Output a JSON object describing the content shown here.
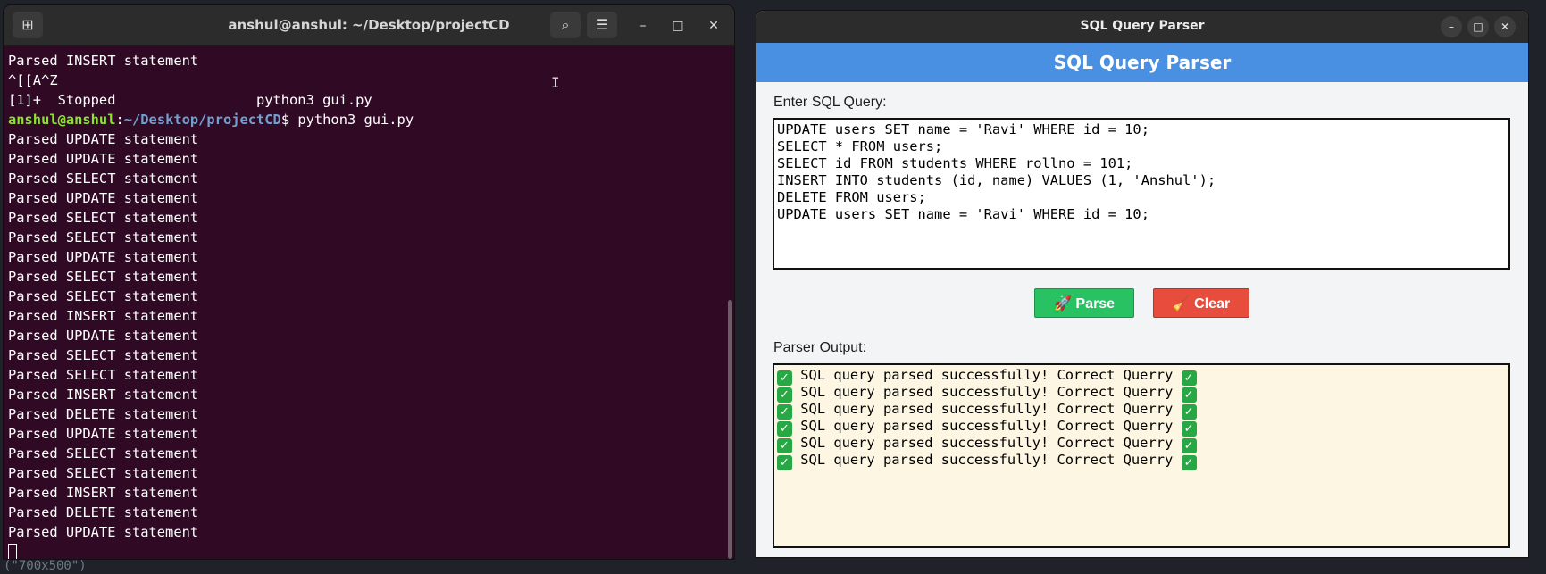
{
  "colors": {
    "terminal_bg": "#300a24",
    "prompt_user": "#8ae234",
    "prompt_path": "#729fcf",
    "header_blue": "#4a90e2",
    "parse_green": "#28c262",
    "clear_red": "#e74c3c",
    "output_bg": "#fdf6e3"
  },
  "desktop": {
    "background_text": "(\"700x500\")"
  },
  "terminal": {
    "title": "anshul@anshul: ~/Desktop/projectCD",
    "icons": {
      "new_tab": "new-tab-icon",
      "search": "search-icon",
      "menu": "hamburger-menu-icon"
    },
    "lines_before_prompt": [
      "Parsed INSERT statement",
      "^[[A^Z",
      "[1]+  Stopped                 python3 gui.py"
    ],
    "prompt": {
      "user": "anshul@anshul",
      "sep": ":",
      "path": "~/Desktop/projectCD",
      "suffix": "$ ",
      "command": "python3 gui.py"
    },
    "output_lines": [
      "Parsed UPDATE statement",
      "Parsed UPDATE statement",
      "Parsed SELECT statement",
      "Parsed UPDATE statement",
      "Parsed SELECT statement",
      "Parsed SELECT statement",
      "Parsed UPDATE statement",
      "Parsed SELECT statement",
      "Parsed SELECT statement",
      "Parsed INSERT statement",
      "Parsed UPDATE statement",
      "Parsed SELECT statement",
      "Parsed SELECT statement",
      "Parsed INSERT statement",
      "Parsed DELETE statement",
      "Parsed UPDATE statement",
      "Parsed SELECT statement",
      "Parsed SELECT statement",
      "Parsed INSERT statement",
      "Parsed DELETE statement",
      "Parsed UPDATE statement"
    ]
  },
  "sql_window": {
    "title": "SQL Query Parser",
    "header": "SQL Query Parser",
    "query_label": "Enter SQL Query:",
    "query_lines": [
      "UPDATE users SET name = 'Ravi' WHERE id = 10;",
      "SELECT * FROM users;",
      "SELECT id FROM students WHERE rollno = 101;",
      "INSERT INTO students (id, name) VALUES (1, 'Anshul');",
      "DELETE FROM users;",
      "UPDATE users SET name = 'Ravi' WHERE id = 10;"
    ],
    "parse_button": {
      "icon": "🚀",
      "label": "Parse"
    },
    "clear_button": {
      "icon": "🧹",
      "label": "Clear"
    },
    "output_label": "Parser Output:",
    "output_lines": [
      "SQL query parsed successfully! Correct Querry",
      "SQL query parsed successfully! Correct Querry",
      "SQL query parsed successfully! Correct Querry",
      "SQL query parsed successfully! Correct Querry",
      "SQL query parsed successfully! Correct Querry",
      "SQL query parsed successfully! Correct Querry"
    ]
  }
}
